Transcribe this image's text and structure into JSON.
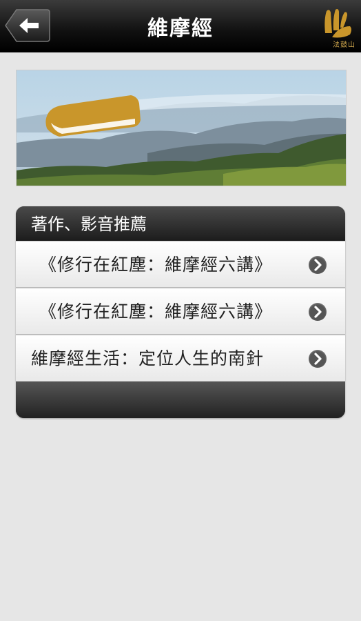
{
  "header": {
    "title": "維摩經",
    "back_icon": "back-arrow-icon",
    "logo_text": "法鼓山"
  },
  "banner": {
    "icon": "book-icon",
    "accent": "#c9962b"
  },
  "section": {
    "title": "著作、影音推薦",
    "items": [
      {
        "label": "《修行在紅塵：維摩經六講》",
        "icon": "chevron-right-icon"
      },
      {
        "label": "《修行在紅塵：維摩經六講》",
        "icon": "chevron-right-icon"
      },
      {
        "label": "維摩經生活：定位人生的南針",
        "icon": "chevron-right-icon"
      }
    ]
  }
}
